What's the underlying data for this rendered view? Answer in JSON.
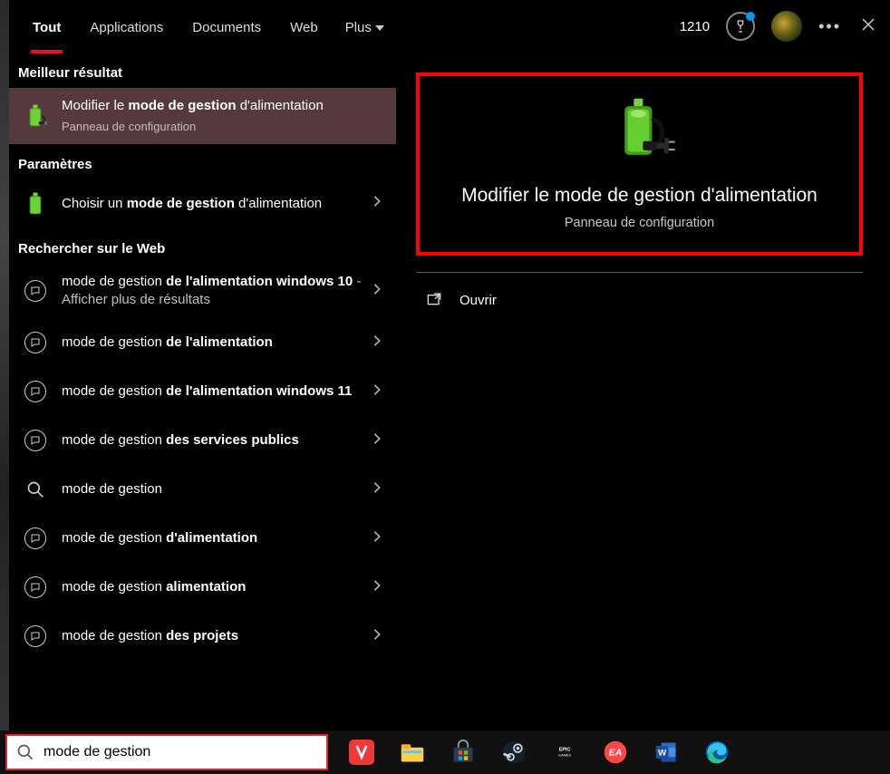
{
  "tabs": {
    "items": [
      "Tout",
      "Applications",
      "Documents",
      "Web"
    ],
    "more": "Plus",
    "active_index": 0
  },
  "rewards": {
    "count": "1210"
  },
  "left": {
    "best_header": "Meilleur résultat",
    "best": {
      "prefix": "Modifier le ",
      "bold": "mode de gestion",
      "suffix": " d'alimentation",
      "sub": "Panneau de configuration"
    },
    "settings_header": "Paramètres",
    "settings_item": {
      "prefix": "Choisir un ",
      "bold": "mode de gestion",
      "suffix": " d'alimentation"
    },
    "web_header": "Rechercher sur le Web",
    "web": [
      {
        "prefix": "mode de gestion ",
        "bold": "de l'alimentation windows 10",
        "suffix": " - Afficher plus de résultats",
        "icon": "chat"
      },
      {
        "prefix": "mode de gestion ",
        "bold": "de l'alimentation",
        "suffix": "",
        "icon": "chat"
      },
      {
        "prefix": "mode de gestion ",
        "bold": "de l'alimentation windows 11",
        "suffix": "",
        "icon": "chat"
      },
      {
        "prefix": "mode de gestion ",
        "bold": "des services publics",
        "suffix": "",
        "icon": "chat"
      },
      {
        "prefix": "mode de gestion",
        "bold": "",
        "suffix": "",
        "icon": "search"
      },
      {
        "prefix": "mode de gestion ",
        "bold": "d'alimentation",
        "suffix": "",
        "icon": "chat"
      },
      {
        "prefix": "mode de gestion ",
        "bold": "alimentation",
        "suffix": "",
        "icon": "chat"
      },
      {
        "prefix": "mode de gestion ",
        "bold": "des projets",
        "suffix": "",
        "icon": "chat"
      }
    ]
  },
  "right": {
    "title": "Modifier le mode de gestion d'alimentation",
    "sub": "Panneau de configuration",
    "action_open": "Ouvrir"
  },
  "search": {
    "value": "mode de gestion"
  }
}
